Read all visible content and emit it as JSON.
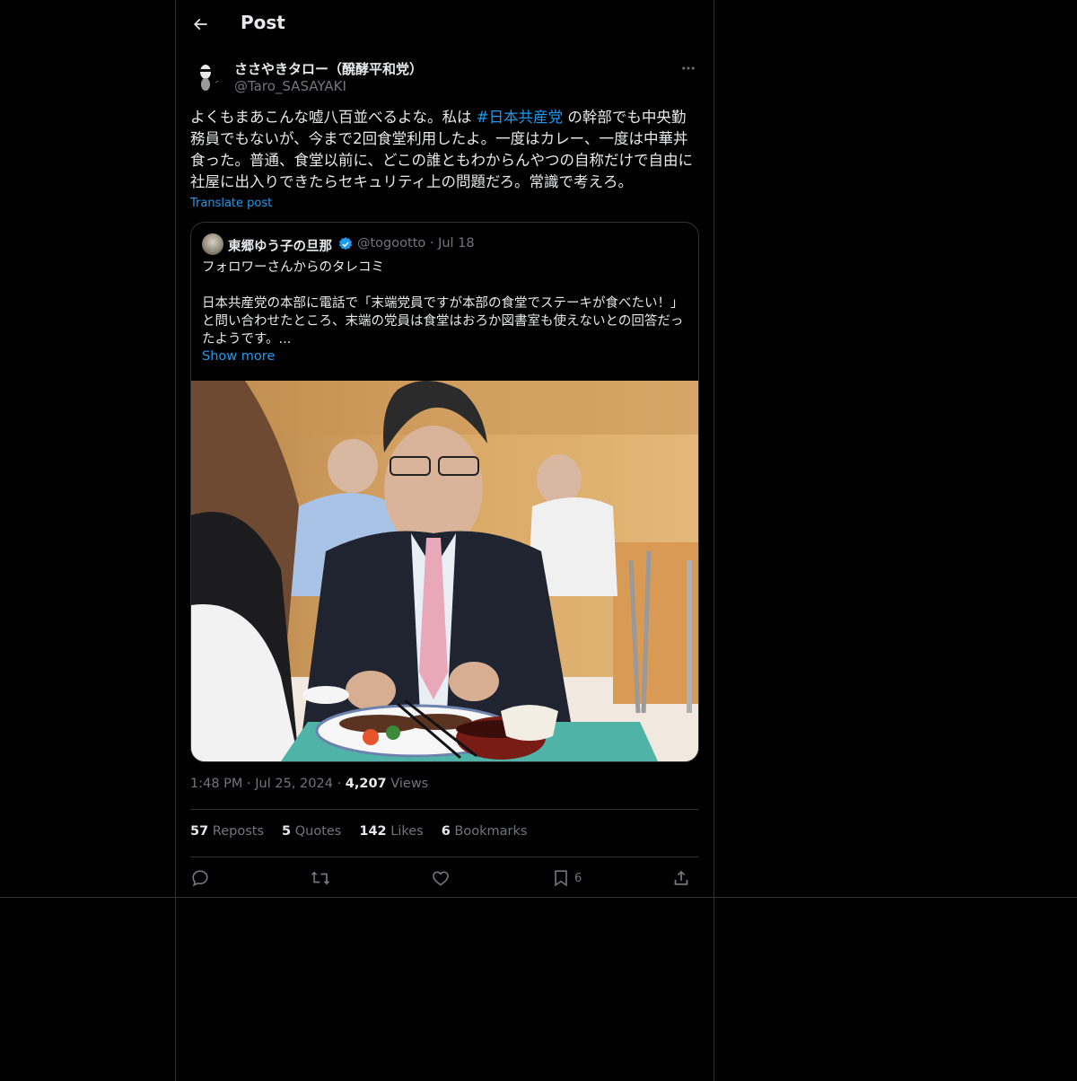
{
  "header": {
    "title": "Post"
  },
  "tweet": {
    "author_name": "ささやきタロー（醗酵平和党）",
    "author_handle": "@Taro_SASAYAKI",
    "text_before": "よくもまあこんな嘘八百並べるよな。私は ",
    "hashtag": "#日本共産党",
    "text_after": " の幹部でも中央勤務員でもないが、今まで2回食堂利用したよ。一度はカレー、一度は中華丼食った。普通、食堂以前に、どこの誰ともわからんやつの自称だけで自由に社屋に出入りできたらセキュリティ上の問題だろ。常識で考えろ。",
    "translate_label": "Translate post"
  },
  "quote": {
    "author_name": "東郷ゆう子の旦那",
    "author_handle": "@togootto",
    "date": "Jul 18",
    "line1": "フォロワーさんからのタレコミ",
    "line2": "日本共産党の本部に電話で「末端党員ですが本部の食堂でステーキが食べたい！」と問い合わせたところ、末端の党員は食堂はおろか図書室も使えないとの回答だったようです。...",
    "show_more": "Show more"
  },
  "meta": {
    "time": "1:48 PM",
    "date": "Jul 25, 2024",
    "views_count": "4,207",
    "views_label": "Views"
  },
  "stats": {
    "reposts_count": "57",
    "reposts_label": "Reposts",
    "quotes_count": "5",
    "quotes_label": "Quotes",
    "likes_count": "142",
    "likes_label": "Likes",
    "bookmarks_count": "6",
    "bookmarks_label": "Bookmarks"
  },
  "actions": {
    "bookmark_count": "6"
  },
  "colors": {
    "background": "#000000",
    "accent": "#1d9bf0",
    "text": "#e7e9ea",
    "muted": "#71767b",
    "border": "#2f3336"
  }
}
